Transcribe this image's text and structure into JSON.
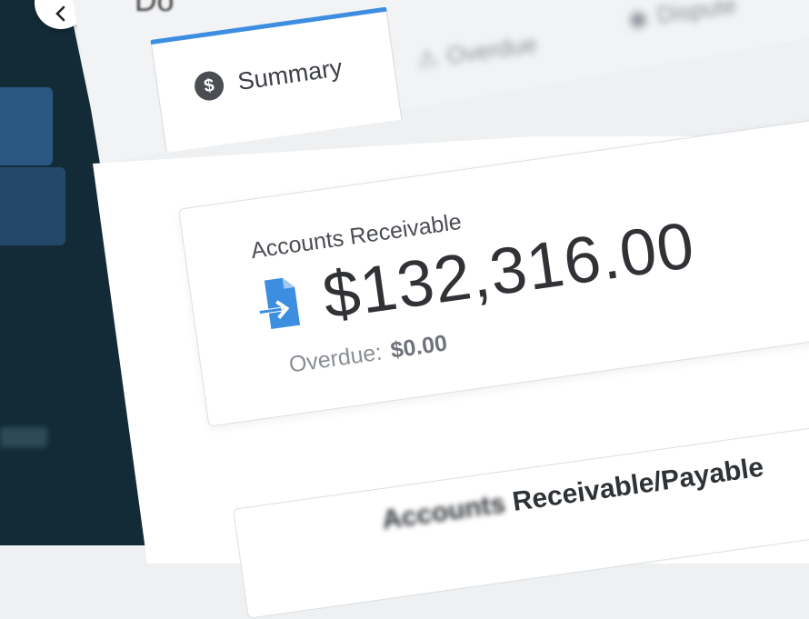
{
  "header": {
    "title": "Do"
  },
  "tabs": [
    {
      "label": "Summary",
      "icon": "dollar-circle-icon",
      "active": true
    },
    {
      "label": "Overdue",
      "icon": "warning-icon",
      "active": false
    },
    {
      "label": "Dispute",
      "icon": "dispute-icon",
      "active": false
    }
  ],
  "summary_card": {
    "label": "Accounts Receivable",
    "amount": "$132,316.00",
    "overdue_label": "Overdue:",
    "overdue_value": "$0.00",
    "icon": "document-import-icon"
  },
  "second_card": {
    "title_prefix": "Accounts",
    "title": "Receivable/Payable"
  },
  "colors": {
    "sidebar": "#132b36",
    "accent": "#3d8ee0",
    "icon_blue": "#3d8ee0"
  }
}
